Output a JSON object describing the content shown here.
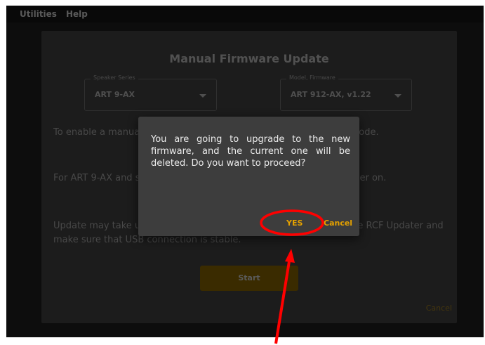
{
  "menubar": {
    "items": [
      "Utilities",
      "Help"
    ]
  },
  "dialog": {
    "title": "Manual Firmware Update",
    "speaker_series": {
      "legend": "Speaker Series",
      "value": "ART 9-AX"
    },
    "model_firmware": {
      "legend": "Model, Firmware",
      "value": "ART 912-AX, v1.22"
    },
    "paragraphs": [
      "To enable a manual update, put the speaker in Firmware Update mode.",
      "For ART 9-AX and similar models, press the knob while turning power on.",
      "Update may take up to a few minutes. Meanwhile, do not terminate RCF Updater and make sure that USB connection is stable."
    ],
    "start_label": "Start",
    "cancel_label": "Cancel"
  },
  "confirm_modal": {
    "message": "You are going to upgrade to the new firmware, and the current one will be deleted. Do you want to proceed?",
    "yes_label": "YES",
    "cancel_label": "Cancel"
  },
  "colors": {
    "accent": "#e4a100",
    "annotation": "#ff0000"
  }
}
